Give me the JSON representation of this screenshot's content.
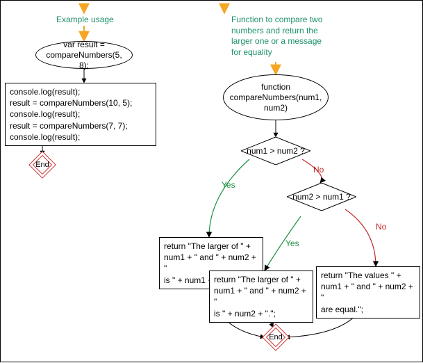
{
  "chart_data": [
    {
      "type": "flowchart",
      "title": "Example usage",
      "nodes": [
        {
          "id": "start1",
          "shape": "ellipse",
          "text": "var result =\ncompareNumbers(5, 8);"
        },
        {
          "id": "proc1",
          "shape": "rect",
          "text": "console.log(result);\nresult = compareNumbers(10, 5);\nconsole.log(result);\nresult = compareNumbers(7, 7);\nconsole.log(result);"
        },
        {
          "id": "end1",
          "shape": "end",
          "text": "End"
        }
      ],
      "edges": [
        {
          "from": "start1",
          "to": "proc1"
        },
        {
          "from": "proc1",
          "to": "end1"
        }
      ]
    },
    {
      "type": "flowchart",
      "title": "Function to compare two numbers and return the larger one or a message for equality",
      "nodes": [
        {
          "id": "start2",
          "shape": "ellipse",
          "text": "function\ncompareNumbers(num1,\nnum2)"
        },
        {
          "id": "d1",
          "shape": "diamond",
          "text": "num1 > num2 ?"
        },
        {
          "id": "d2",
          "shape": "diamond",
          "text": "num2 > num1 ?"
        },
        {
          "id": "r1",
          "shape": "rect",
          "text": "return \"The larger of \" +\nnum1 + \" and \" + num2 + \"\nis \" + num1 + \".\";"
        },
        {
          "id": "r2",
          "shape": "rect",
          "text": "return \"The larger of \" +\nnum1 + \" and \" + num2 + \"\nis \" + num2 + \".\";"
        },
        {
          "id": "r3",
          "shape": "rect",
          "text": "return \"The values \" +\nnum1 + \" and \" + num2 + \"\nare equal.\";"
        },
        {
          "id": "end2",
          "shape": "end",
          "text": "End"
        }
      ],
      "edges": [
        {
          "from": "start2",
          "to": "d1"
        },
        {
          "from": "d1",
          "to": "r1",
          "label": "Yes"
        },
        {
          "from": "d1",
          "to": "d2",
          "label": "No"
        },
        {
          "from": "d2",
          "to": "r2",
          "label": "Yes"
        },
        {
          "from": "d2",
          "to": "r3",
          "label": "No"
        },
        {
          "from": "r1",
          "to": "end2"
        },
        {
          "from": "r2",
          "to": "end2"
        },
        {
          "from": "r3",
          "to": "end2"
        }
      ]
    }
  ],
  "labels": {
    "comment_left": "Example usage",
    "comment_right": "Function to compare two\nnumbers and return the\nlarger one or a message\nfor equality",
    "start_left": "var result =\ncompareNumbers(5, 8);",
    "proc_left": "console.log(result);\nresult = compareNumbers(10, 5);\nconsole.log(result);\nresult = compareNumbers(7, 7);\nconsole.log(result);",
    "end": "End",
    "start_right": "function\ncompareNumbers(num1,\nnum2)",
    "d1": "num1 > num2 ?",
    "d2": "num2 > num1 ?",
    "r1": "return \"The larger of \" +\nnum1 + \" and \" + num2 + \"\nis \" + num1 + \".\";",
    "r2": "return \"The larger of \" +\nnum1 + \" and \" + num2 + \"\nis \" + num2 + \".\";",
    "r3": "return \"The values \" +\nnum1 + \" and \" + num2 + \"\nare equal.\";",
    "yes": "Yes",
    "no": "No"
  }
}
